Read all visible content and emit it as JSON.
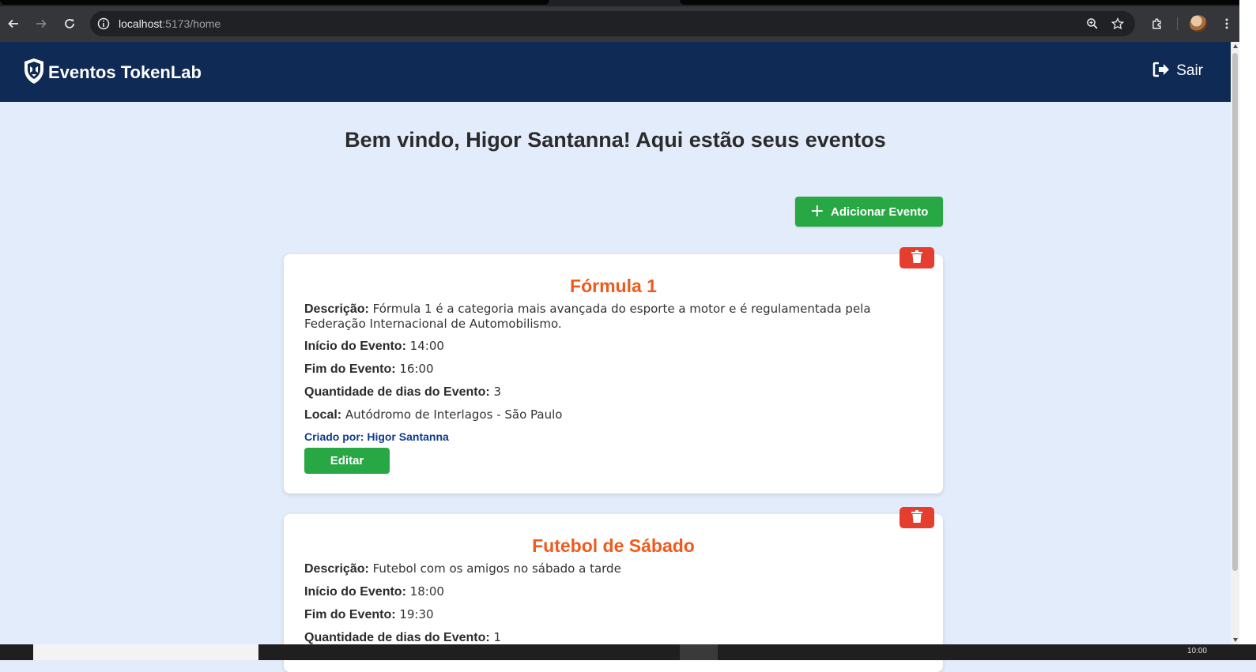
{
  "browser": {
    "url_host": "localhost",
    "url_rest": ":5173/home"
  },
  "header": {
    "app_title": "Eventos TokenLab",
    "logout_label": "Sair"
  },
  "main": {
    "welcome": "Bem vindo, Higor Santanna! Aqui estão seus eventos",
    "add_button_label": "Adicionar Evento"
  },
  "labels": {
    "description": "Descrição:",
    "start": "Início do Evento:",
    "end": "Fim do Evento:",
    "days": "Quantidade de dias do Evento:",
    "location": "Local:",
    "edit": "Editar"
  },
  "events": [
    {
      "title": "Fórmula 1",
      "description": "Fórmula 1 é a categoria mais avançada do esporte a motor e é regulamentada pela Federação Internacional de Automobilismo.",
      "start": "14:00",
      "end": "16:00",
      "days": "3",
      "location": "Autódromo de Interlagos - São Paulo",
      "created_by": "Criado por: Higor Santanna"
    },
    {
      "title": "Futebol de Sábado",
      "description": "Futebol com os amigos no sábado a tarde",
      "start": "18:00",
      "end": "19:30",
      "days": "1"
    }
  ],
  "taskbar": {
    "clock": "10:00"
  },
  "colors": {
    "header_bg": "#0f2a55",
    "page_bg": "#e3ecfb",
    "primary_green": "#28a745",
    "danger_red": "#e53e2f",
    "title_orange": "#f05a1c"
  }
}
